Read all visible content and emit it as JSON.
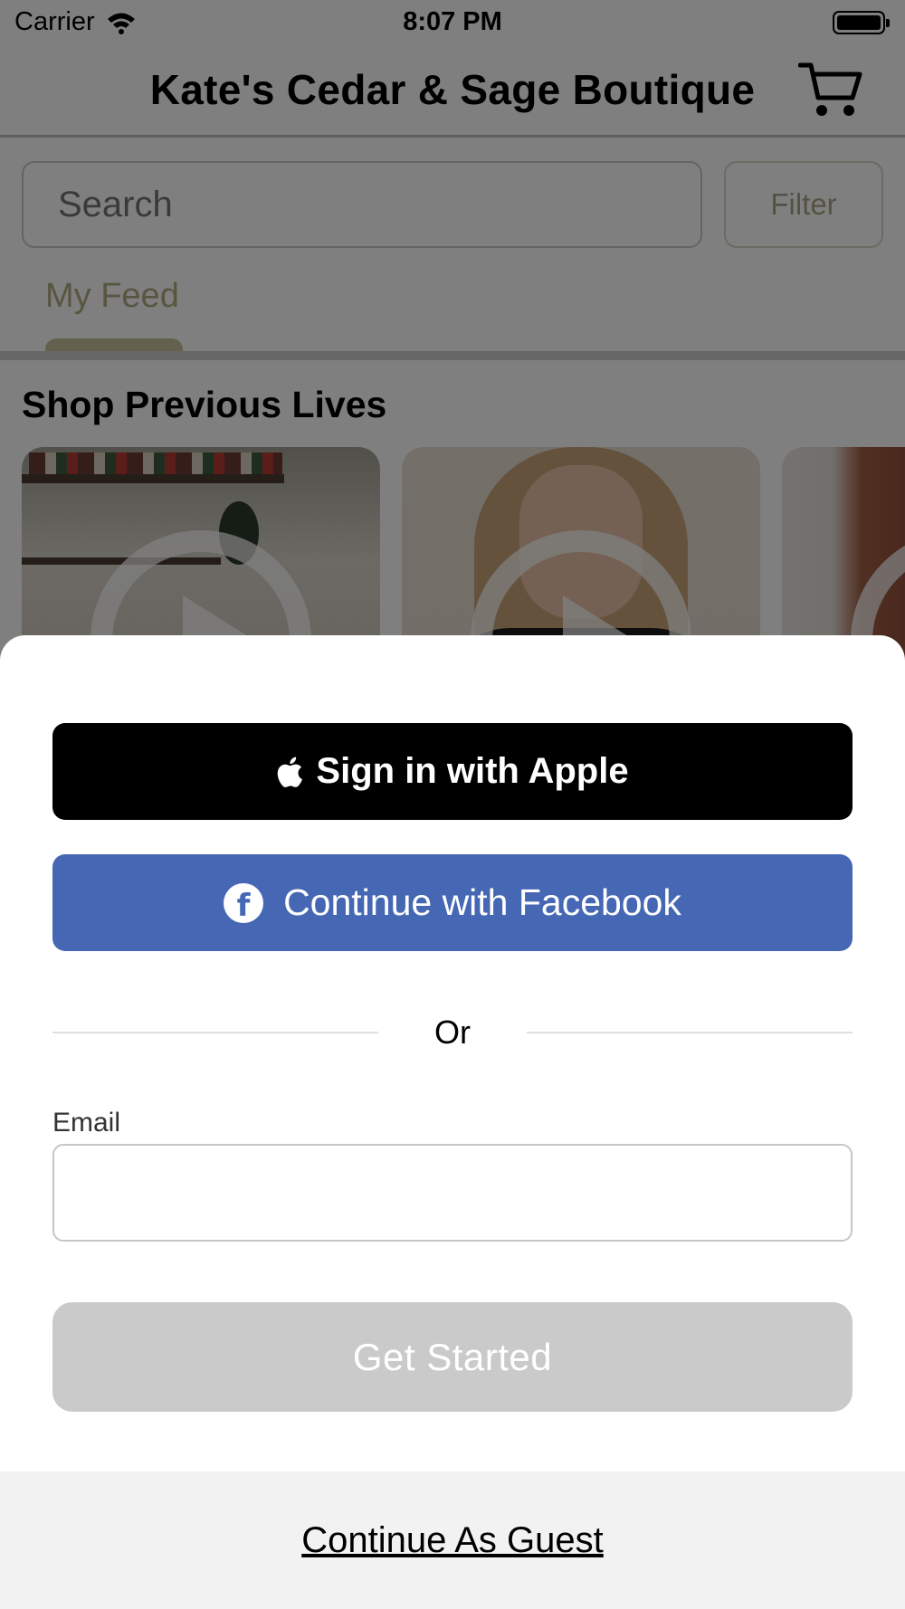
{
  "status_bar": {
    "carrier": "Carrier",
    "time": "8:07 PM",
    "wifi_icon": "wifi-icon",
    "battery_icon": "battery-icon",
    "battery_level": 1.0
  },
  "header": {
    "title": "Kate's Cedar & Sage Boutique",
    "cart_icon": "cart-icon"
  },
  "search": {
    "placeholder": "Search",
    "filter_label": "Filter"
  },
  "tabs": [
    {
      "label": "My Feed",
      "selected": true
    }
  ],
  "section": {
    "title": "Shop Previous Lives",
    "play_icon": "play-icon"
  },
  "sheet": {
    "apple_button_label": "Sign in with Apple",
    "apple_icon": "apple-icon",
    "facebook_button_label": "Continue with Facebook",
    "facebook_icon": "facebook-icon",
    "divider_text": "Or",
    "email_label": "Email",
    "email_value": "",
    "get_started_label": "Get Started",
    "guest_label": "Continue As Guest"
  },
  "colors": {
    "accent": "#c7c39c",
    "facebook": "#4567b4",
    "apple": "#000000",
    "disabled_button": "#cacaca",
    "overlay": "rgba(0,0,0,0.5)"
  }
}
